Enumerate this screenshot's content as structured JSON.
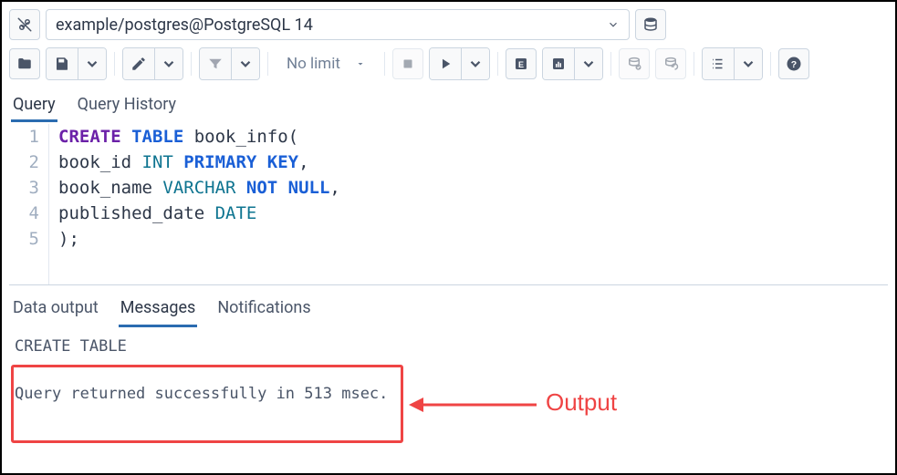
{
  "connection": {
    "label": "example/postgres@PostgreSQL 14"
  },
  "toolbar": {
    "nolimit": "No limit"
  },
  "tabs": {
    "query": "Query",
    "history": "Query History"
  },
  "editor": {
    "lines": [
      "1",
      "2",
      "3",
      "4",
      "5"
    ],
    "create": "CREATE",
    "table": "TABLE",
    "tname": " book_info(",
    "col1": "book_id ",
    "int": "INT",
    "pk": " PRIMARY KEY",
    "comma": ",",
    "col2": "book_name ",
    "varchar": "VARCHAR",
    "notnull": " NOT NULL",
    "col3": "published_date ",
    "date": "DATE",
    "close": ");"
  },
  "output_tabs": {
    "data": "Data output",
    "messages": "Messages",
    "notifications": "Notifications"
  },
  "output": {
    "line1": "CREATE TABLE",
    "line2": "Query returned successfully in 513 msec."
  },
  "annotation": {
    "label": "Output"
  }
}
